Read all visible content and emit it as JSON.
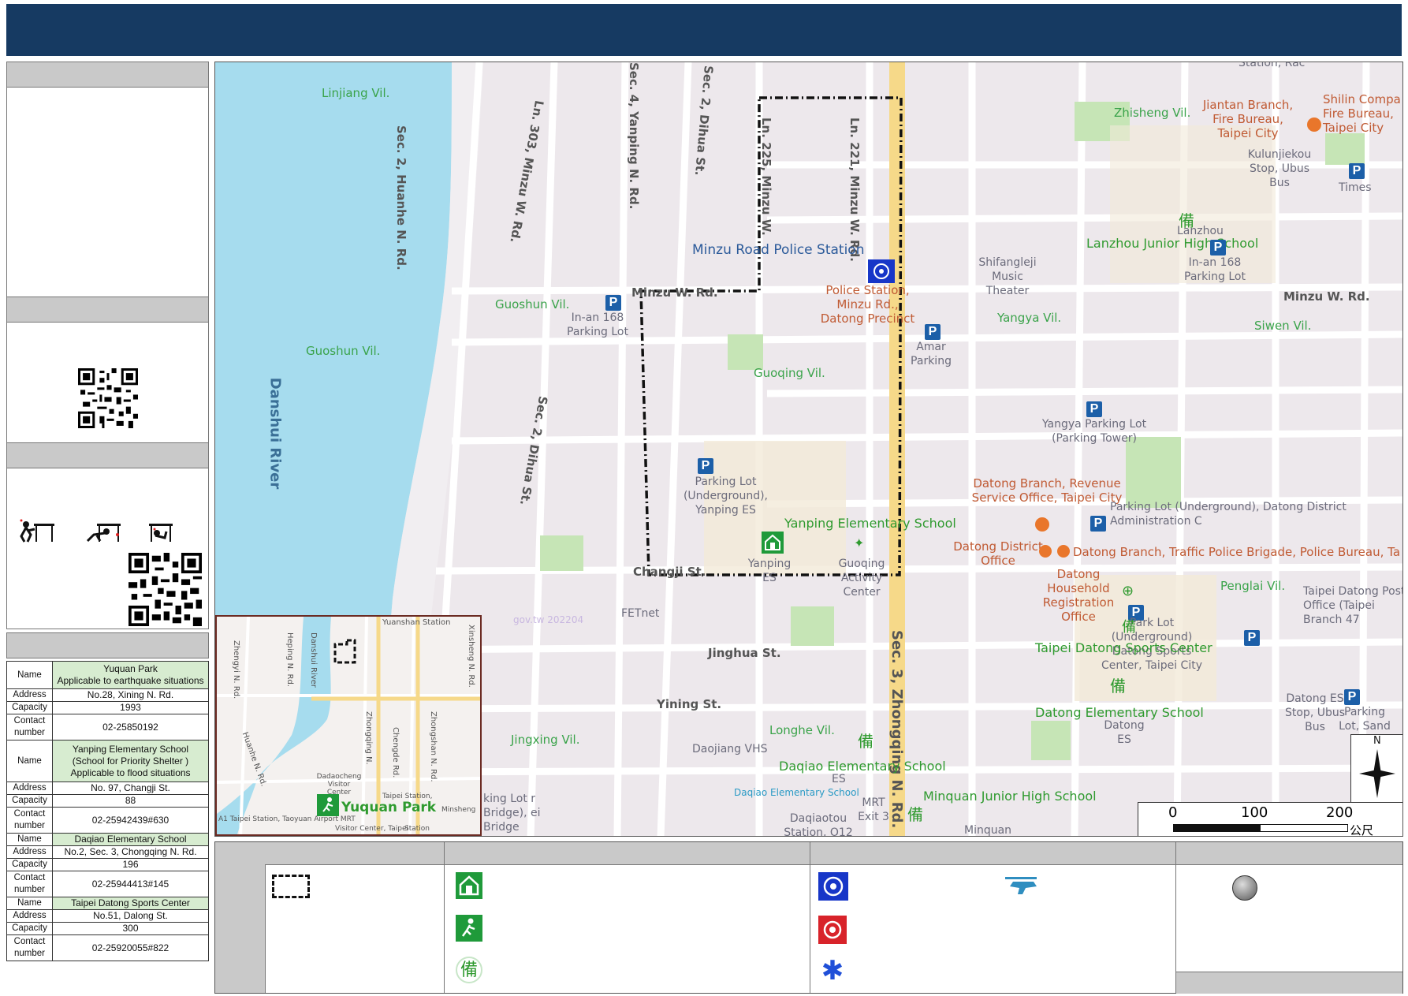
{
  "map": {
    "villages": [
      "Linjiang Vil.",
      "Guoshun Vil.",
      "Guoshun Vil.",
      "Guoqing Vil.",
      "Zhisheng Vil.",
      "Yangya Vil.",
      "Siwen Vil.",
      "Penglai Vil.",
      "Longhe Vil.",
      "Jingxing Vil."
    ],
    "river": "Danshui River",
    "roads": [
      "Sec. 2, Huanhe N. Rd.",
      "Ln. 303, Minzu W. Rd.",
      "Sec. 4, Yanping N. Rd.",
      "Sec. 2, Dihua St.",
      "Ln. 225, Minzu W.",
      "Ln. 221, Minzu W. Rd.",
      "Minzu W. Rd.",
      "Minzu W. Rd.",
      "Sec. 2, Dihua St.",
      "Changji St.",
      "Jinghua St.",
      "Yining St.",
      "Sec. 3, Zhongqing N. Rd."
    ],
    "pois": {
      "police_station_label": "Minzu Road Police Station",
      "police_detail": "Police Station, Minzu Rd., Datong Precinct",
      "fire_bureau": "Jiantan Branch, Fire Bureau, Taipei City",
      "fire_bureau2": "Shilin Compa Fire Bureau, Taipei City",
      "bus_stop": "Kulunjiekou Stop, Ubus Bus",
      "times": "Times",
      "music_theater": "Shifangleji Music Theater",
      "lanzhou_school": "Lanzhou Junior High School",
      "lanzhou": "Lanzhou",
      "inan_parking": "In-an 168 Parking Lot",
      "inan_parking_left": "In-an 168 Parking Lot",
      "amar_parking": "Amar Parking",
      "yangya_parking": "Yangya Parking Lot (Parking Tower)",
      "yanping_parking": "Parking Lot (Underground), Yanping ES",
      "yanping_school": "Yanping Elementary School",
      "yanping_es": "Yanping ES",
      "guoqing_center": "Guoqing Activity Center",
      "revenue": "Datong Branch, Revenue Service Office, Taipei City",
      "parking_datong": "Parking Lot (Underground), Datong District Administration C",
      "district_office": "Datong District Office",
      "traffic_police": "Datong Branch, Traffic Police Brigade, Police Bureau, Ta",
      "household": "Datong Household Registration Office",
      "post_office": "Taipei Datong Post Office (Taipei Branch 47",
      "sports_center": "Taipei Datong Sports Center",
      "park_lot": "Park Lot (Underground) Datong Sports Center, Taipei City",
      "datong_school": "Datong Elementary School",
      "datong_es": "Datong ES",
      "datong_bus": "Datong ES Stop, Ubus Bus",
      "parking_sand": "Parking Lot, Sand",
      "fetnet": "FETnet",
      "daojiang": "Daojiang VHS",
      "daqiao_school": "Daqiao Elementary School",
      "daqiao_es": "ES",
      "daqiao_small": "Daqiao Elementary School",
      "minquan_school": "Minquan Junior High School",
      "mrt": "MRT Exit 3",
      "daqiaotou": "Daqiaotou Station, O12",
      "minquan": "Minquan",
      "parking_bridge": "king Lot r Bridge), ei Bridge",
      "url_stamp": "gov.tw 202204",
      "station_top": "Station, Rac"
    },
    "scale": {
      "ticks": [
        "0",
        "100",
        "200"
      ],
      "unit": "公尺"
    },
    "north": "N"
  },
  "inset": {
    "labels": [
      "Yuanshan Station",
      "Danshui River",
      "Heping N. Rd.",
      "Zhengyi N. Rd.",
      "Chengde Rd.",
      "Zhongshan N. Rd.",
      "Xinsheng N. Rd.",
      "Huanhe N. Rd.",
      "Dadaocheng Visitor Center",
      "Taipei Station,",
      "A1 Taipei Station, Taoyuan Airport MRT",
      "Visitor Center, Taipei",
      "Station",
      "Zhongqing N.",
      "Minsheng"
    ],
    "park_label": "Yuquan Park"
  },
  "shelters": [
    {
      "name_label": "Name",
      "name": "Yuquan Park",
      "note": "Applicable to earthquake situations",
      "address_label": "Address",
      "address": "No.28, Xining N. Rd.",
      "capacity_label": "Capacity",
      "capacity": "1993",
      "contact_label": "Contact number",
      "contact": "02-25850192"
    },
    {
      "name_label": "Name",
      "name": "Yanping Elementary School",
      "note": "(School for Priority Shelter ) Applicable to flood situations",
      "address_label": "Address",
      "address": "No. 97, Changji St.",
      "capacity_label": "Capacity",
      "capacity": "88",
      "contact_label": "Contact number",
      "contact": "02-25942439#630"
    },
    {
      "name_label": "Name",
      "name": "Daqiao Elementary School",
      "note": "",
      "address_label": "Address",
      "address": "No.2, Sec. 3, Chongqing N. Rd.",
      "capacity_label": "Capacity",
      "capacity": "196",
      "contact_label": "Contact number",
      "contact": "02-25944413#145"
    },
    {
      "name_label": "Name",
      "name": "Taipei Datong Sports Center",
      "note": "",
      "address_label": "Address",
      "address": "No.51, Dalong St.",
      "capacity_label": "Capacity",
      "capacity": "300",
      "contact_label": "Contact number",
      "contact": "02-25920055#822"
    }
  ],
  "legend": {
    "icons": [
      "boundary",
      "shelter",
      "outdoor-evacuation",
      "reserve",
      "police",
      "fire",
      "medical",
      "helicopter",
      "node"
    ]
  },
  "colors": {
    "header": "#163a62",
    "river": "#a6dcee",
    "shelter_green": "#1f9a3a",
    "parking": "#1c5fa8",
    "zhongqing_road": "#f6d989"
  }
}
